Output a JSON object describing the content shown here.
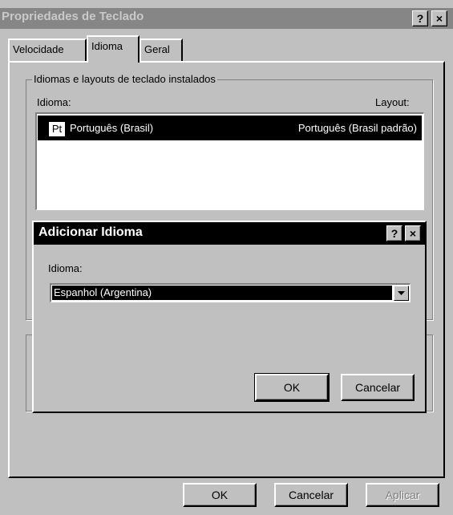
{
  "window": {
    "title": "Propriedades de Teclado",
    "help_glyph": "?",
    "close_glyph": "×"
  },
  "tabs": [
    {
      "label": "Velocidade"
    },
    {
      "label": "Idioma"
    },
    {
      "label": "Geral"
    }
  ],
  "installed_group": {
    "legend": "Idiomas e layouts de teclado instalados",
    "col_language": "Idioma:",
    "col_layout": "Layout:",
    "rows": [
      {
        "badge": "Pt",
        "language": "Português (Brasil)",
        "layout": "Português (Brasil padrão)"
      }
    ]
  },
  "footer": {
    "ok": "OK",
    "cancel": "Cancelar",
    "apply": "Aplicar"
  },
  "dialog": {
    "title": "Adicionar Idioma",
    "help_glyph": "?",
    "close_glyph": "×",
    "field_label": "Idioma:",
    "selected_value": "Espanhol (Argentina)",
    "ok": "OK",
    "cancel": "Cancelar"
  },
  "colors": {
    "face": "#c0c0c0",
    "inactive_title": "#868686",
    "active_title": "#000000",
    "selection": "#000000"
  }
}
